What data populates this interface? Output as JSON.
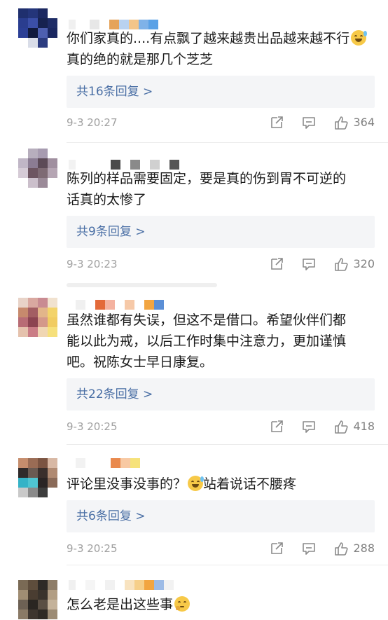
{
  "comments": [
    {
      "text": "你们家真的....有点飘了越来越贵出品越来越不行",
      "text2": "真的绝的就是那几个芝芝",
      "emoji": "sweat-smile-emoji",
      "reply_label": "共16条回复 >",
      "time": "9-3 20:27",
      "likes": "364"
    },
    {
      "text": "陈列的样品需要固定，要是真的伤到胃不可逆的",
      "text2": "话真的太惨了",
      "reply_label": "共9条回复 >",
      "time": "9-3 20:23",
      "likes": "320"
    },
    {
      "text": "虽然谁都有失误，但这不是借口。希望伙伴们都",
      "text2": "能以此为戒，以后工作时集中注意力，更加谨慎",
      "text3": "吧。祝陈女士早日康复。",
      "reply_label": "共22条回复 >",
      "time": "9-3 20:25",
      "likes": "418"
    },
    {
      "text": "评论里没事没事的？",
      "text_after_emoji": "站着说话不腰疼",
      "emoji": "sweat-smile-emoji",
      "reply_label": "共6条回复 >",
      "time": "9-3 20:25",
      "likes": "288"
    },
    {
      "text": "怎么老是出这些事",
      "emoji": "thinking-emoji"
    }
  ],
  "icons": {
    "share": "share-icon",
    "reply": "comment-icon",
    "like": "thumbs-up-icon"
  },
  "colors": {
    "reply_link": "#4a6fa5",
    "reply_bg": "#f4f5f7",
    "meta_text": "#a0a0a0"
  }
}
